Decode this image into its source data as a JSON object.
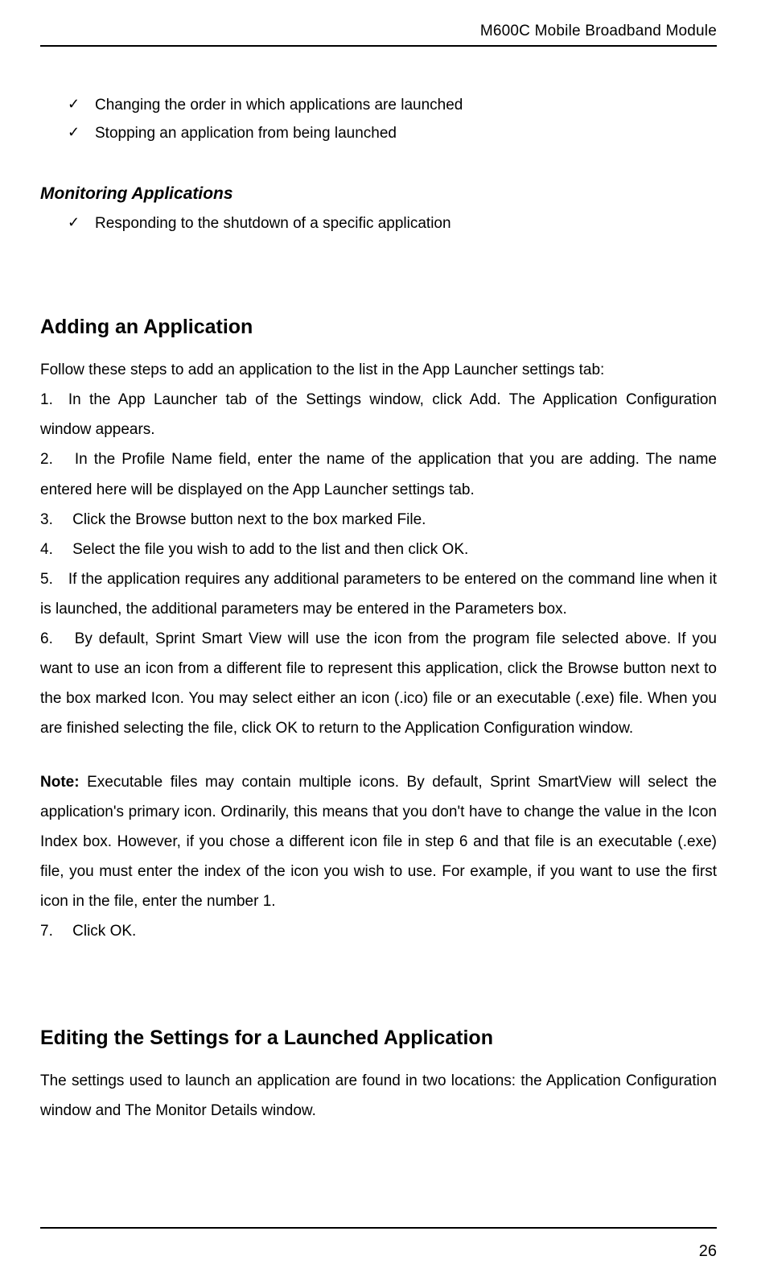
{
  "header": {
    "title": "M600C Mobile Broadband Module"
  },
  "topChecks": [
    "Changing the order in which applications are launched",
    "Stopping an application from being launched"
  ],
  "monitoring": {
    "heading": "Monitoring Applications",
    "items": [
      "Responding to the shutdown of a specific application"
    ]
  },
  "adding": {
    "heading": "Adding an Application",
    "intro": "Follow these steps to add an application to the list in the App Launcher settings tab:",
    "steps": {
      "s1": "1. In the App Launcher tab of the Settings window, click Add. The Application Configuration window appears.",
      "s2": "2.  In the Profile Name field, enter the name of the application that you are adding. The name entered here will be displayed on the App Launcher settings tab.",
      "s3": "3.  Click the Browse button next to the box marked File.",
      "s4": "4.  Select the file you wish to add to the list and then click OK.",
      "s5": "5. If the application requires any additional parameters to be entered on the command line when it is launched, the additional parameters may be entered in the Parameters box.",
      "s6": "6.  By default, Sprint Smart View will use the icon from the program file selected above. If you want to use an icon from a different file to represent this application, click the Browse button next to the box marked Icon. You may select either an icon (.ico) file or an executable (.exe) file. When you are finished selecting the file, click OK to return to the Application Configuration window.",
      "noteLabel": "Note:",
      "noteBody": " Executable files may contain multiple icons. By default, Sprint SmartView will select the application's primary icon. Ordinarily, this means that you don't have to change the value in the Icon Index box. However, if you chose a different icon file in step 6 and that file is an executable (.exe) file, you must enter the index of the icon you wish to use. For example, if you want to use the first icon in the file, enter the number 1.",
      "s7": "7.  Click OK."
    }
  },
  "editing": {
    "heading": "Editing the Settings for a Launched Application",
    "body": "The settings used to launch an application are found in two locations: the Application Configuration window and The Monitor Details window."
  },
  "pageNumber": "26"
}
